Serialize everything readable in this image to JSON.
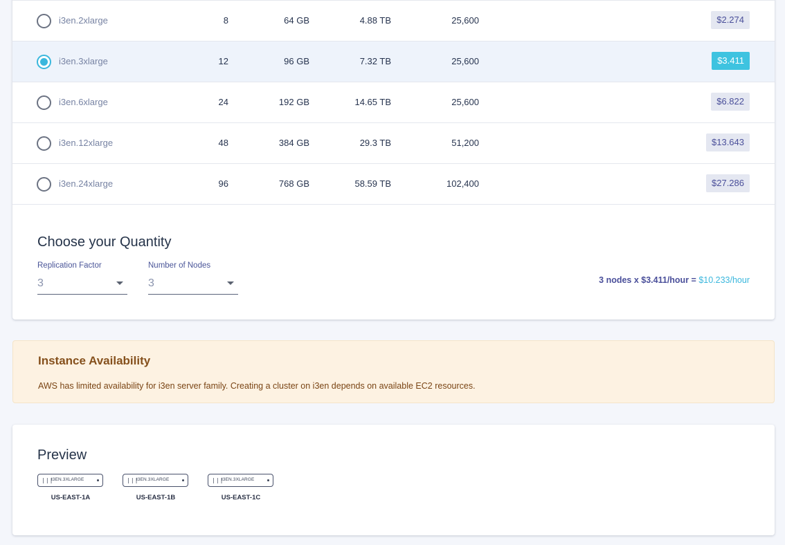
{
  "colors": {
    "accent": "#3ec3e0",
    "price_badge_bg": "#e4e7f1",
    "price_badge_text": "#4a4f9a",
    "warning_bg": "#fdf2e2",
    "warning_text": "#85501c"
  },
  "instances": [
    {
      "name": "i3en.2xlarge",
      "vcpus": "8",
      "memory": "64 GB",
      "storage": "4.88 TB",
      "network": "25,600",
      "price": "$2.274",
      "selected": false
    },
    {
      "name": "i3en.3xlarge",
      "vcpus": "12",
      "memory": "96 GB",
      "storage": "7.32 TB",
      "network": "25,600",
      "price": "$3.411",
      "selected": true
    },
    {
      "name": "i3en.6xlarge",
      "vcpus": "24",
      "memory": "192 GB",
      "storage": "14.65 TB",
      "network": "25,600",
      "price": "$6.822",
      "selected": false
    },
    {
      "name": "i3en.12xlarge",
      "vcpus": "48",
      "memory": "384 GB",
      "storage": "29.3 TB",
      "network": "51,200",
      "price": "$13.643",
      "selected": false
    },
    {
      "name": "i3en.24xlarge",
      "vcpus": "96",
      "memory": "768 GB",
      "storage": "58.59 TB",
      "network": "102,400",
      "price": "$27.286",
      "selected": false
    }
  ],
  "quantity": {
    "title": "Choose your Quantity",
    "replication_factor": {
      "label": "Replication Factor",
      "value": "3"
    },
    "number_of_nodes": {
      "label": "Number of Nodes",
      "value": "3"
    },
    "summary_prefix": "3 nodes x $3.411/hour = ",
    "summary_total": "$10.233/hour"
  },
  "availability": {
    "title": "Instance Availability",
    "text": "AWS has limited availability for i3en server family. Creating a cluster on i3en depends on available EC2 resources."
  },
  "preview": {
    "title": "Preview",
    "nodes": [
      {
        "type": "I3EN.3XLARGE",
        "zone": "US-EAST-1A"
      },
      {
        "type": "I3EN.3XLARGE",
        "zone": "US-EAST-1B"
      },
      {
        "type": "I3EN.3XLARGE",
        "zone": "US-EAST-1C"
      }
    ]
  }
}
